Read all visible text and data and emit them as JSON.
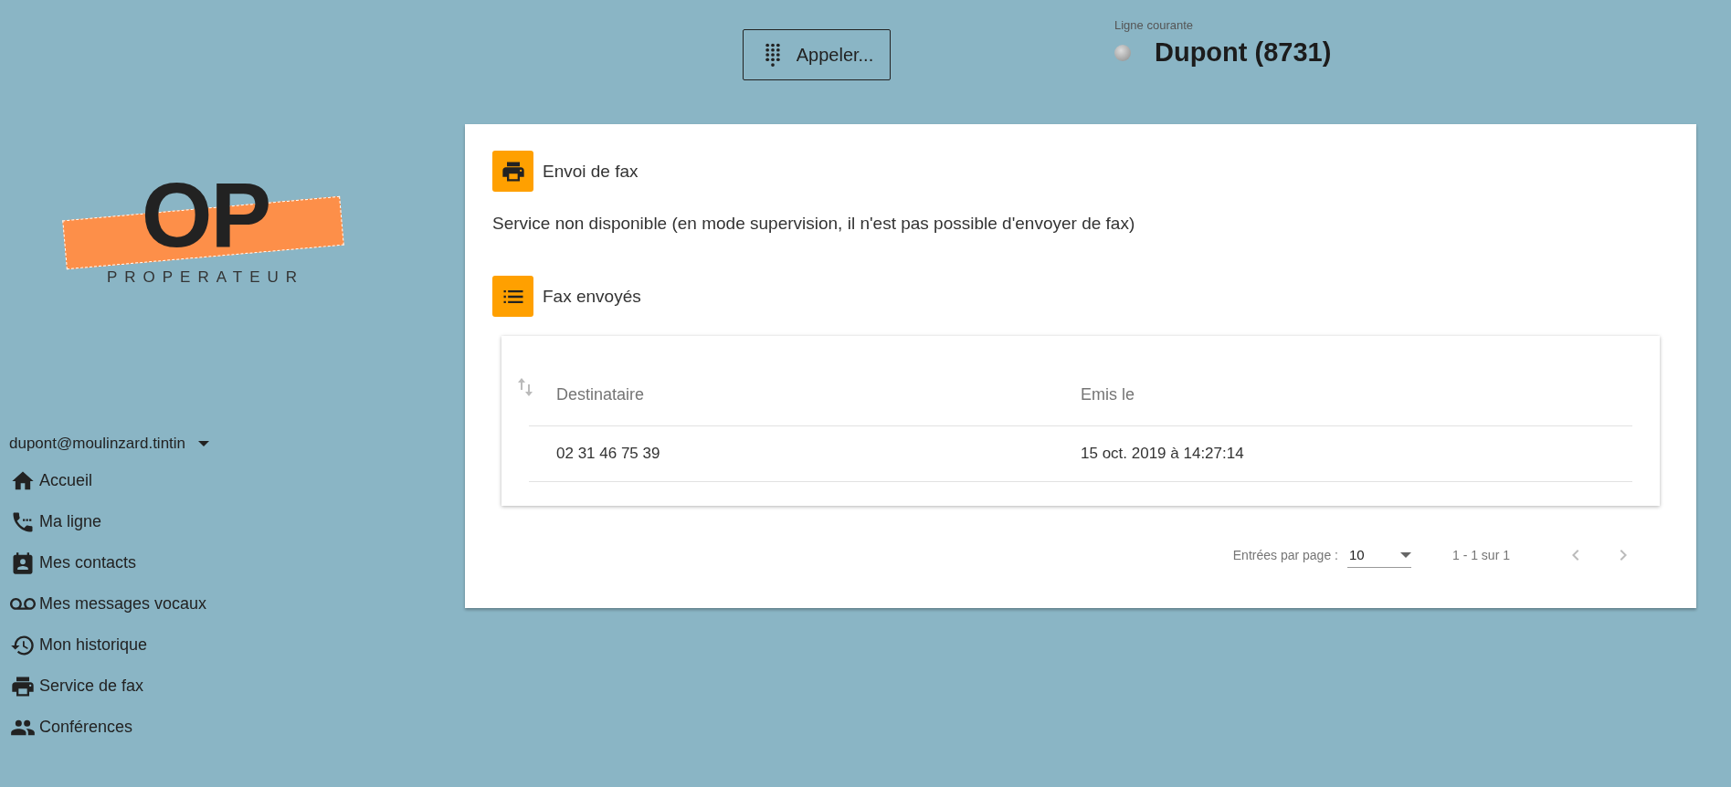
{
  "header": {
    "call_button": "Appeler...",
    "current_line": {
      "label": "Ligne courante",
      "name": "Dupont (8731)"
    }
  },
  "logo": {
    "mark": "OP",
    "name": "PROPERATEUR"
  },
  "sidebar": {
    "account": "dupont@moulinzard.tintin",
    "items": [
      {
        "label": "Accueil"
      },
      {
        "label": "Ma ligne"
      },
      {
        "label": "Mes contacts"
      },
      {
        "label": "Mes messages vocaux"
      },
      {
        "label": "Mon historique"
      },
      {
        "label": "Service de fax"
      },
      {
        "label": "Conférences"
      }
    ]
  },
  "fax_send": {
    "title": "Envoi de fax",
    "message": "Service non disponible (en mode supervision, il n'est pas possible d'envoyer de fax)"
  },
  "fax_sent": {
    "title": "Fax envoyés",
    "table": {
      "columns": [
        "Destinataire",
        "Emis le"
      ],
      "rows": [
        [
          "02 31 46 75 39",
          "15 oct. 2019 à 14:27:14"
        ]
      ]
    },
    "pagination": {
      "label": "Entrées par page :",
      "page_size": "10",
      "range": "1 - 1 sur 1",
      "prev": {
        "disabled": true
      },
      "next": {
        "disabled": true
      }
    }
  }
}
